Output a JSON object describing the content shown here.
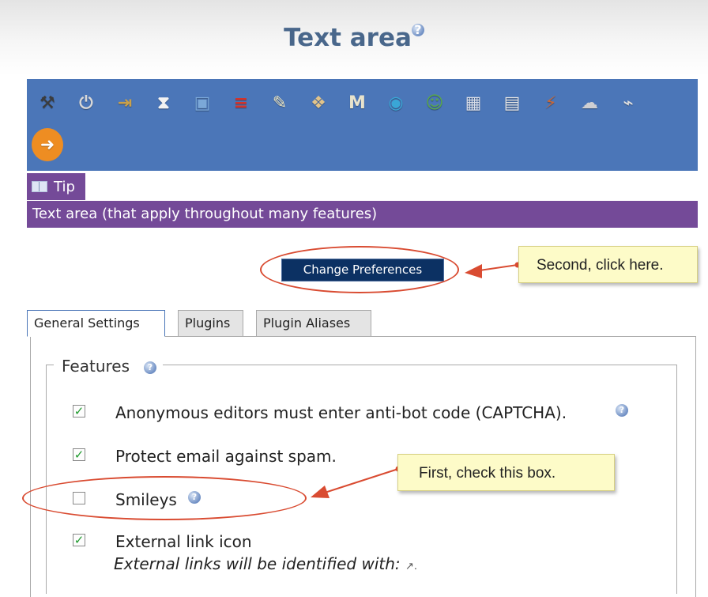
{
  "title": "Text area",
  "toolbar": {
    "icons": [
      {
        "name": "settings-icon",
        "glyph": "⚒",
        "color": "#3b3b3b"
      },
      {
        "name": "power-icon",
        "glyph": "⏻",
        "color": "#d8d8d8"
      },
      {
        "name": "login-icon",
        "glyph": "⇥",
        "color": "#c9a04a"
      },
      {
        "name": "hourglass-icon",
        "glyph": "⧗",
        "color": "#f2f2f2"
      },
      {
        "name": "image-gallery-icon",
        "glyph": "▣",
        "color": "#7ba8d8"
      },
      {
        "name": "german-flag-icon",
        "glyph": "≡",
        "color": "#d4332a"
      },
      {
        "name": "notepad-icon",
        "glyph": "✎",
        "color": "#f1e9c4"
      },
      {
        "name": "puzzle-icon",
        "glyph": "❖",
        "color": "#e2c48a"
      },
      {
        "name": "mail-icon",
        "glyph": "M",
        "color": "#e8e3cc"
      },
      {
        "name": "globe-icon",
        "glyph": "◉",
        "color": "#3aa6d6"
      },
      {
        "name": "users-icon",
        "glyph": "☺",
        "color": "#5aa84c"
      },
      {
        "name": "calendar-icon",
        "glyph": "▦",
        "color": "#d8dde8"
      },
      {
        "name": "files-icon",
        "glyph": "▤",
        "color": "#e6e6e6"
      },
      {
        "name": "plugins-icon",
        "glyph": "⚡",
        "color": "#c7683a"
      },
      {
        "name": "brain-icon",
        "glyph": "☁",
        "color": "#cfcfd2"
      },
      {
        "name": "satellite-dish-icon",
        "glyph": "⌁",
        "color": "#e0e0e0"
      },
      {
        "name": "arrow-right-icon",
        "glyph": "➜",
        "color": "#f19a2a"
      }
    ]
  },
  "tip": {
    "label": "Tip",
    "message": "Text area (that apply throughout many features)"
  },
  "change_preferences_label": "Change Preferences",
  "callouts": {
    "second": "Second, click here.",
    "first": "First, check this box."
  },
  "tabs": [
    {
      "label": "General Settings",
      "active": true
    },
    {
      "label": "Plugins",
      "active": false
    },
    {
      "label": "Plugin Aliases",
      "active": false
    }
  ],
  "features": {
    "legend": "Features",
    "options": [
      {
        "label": "Anonymous editors must enter anti-bot code (CAPTCHA).",
        "checked": true,
        "help": true
      },
      {
        "label": "Protect email against spam.",
        "checked": true,
        "help": false
      },
      {
        "label": "Smileys",
        "checked": false,
        "help": true
      },
      {
        "label": "External link icon",
        "checked": true,
        "help": false
      }
    ],
    "external_note": "External links will be identified with: ",
    "external_note_icon": "↗."
  },
  "colors": {
    "title": "#49678b",
    "toolbar": "#4b76b8",
    "tip_bar": "#744a98",
    "button": "#0c3163",
    "annotation": "#d94b31",
    "callout_bg": "#fdfbc8"
  }
}
